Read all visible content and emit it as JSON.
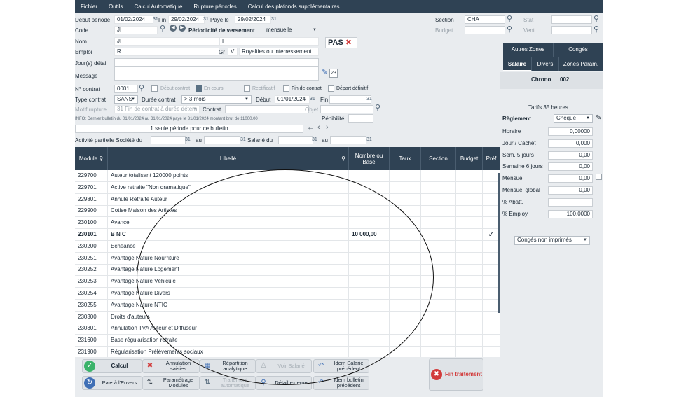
{
  "menu": [
    "Fichier",
    "Outils",
    "Calcul Automatique",
    "Rupture périodes",
    "Calcul des plafonds supplémentaires"
  ],
  "header": {
    "debut_periode_label": "Début période",
    "debut_periode": "01/02/2024",
    "fin_label": "Fin",
    "fin": "29/02/2024",
    "paye_le_label": "Payé le",
    "paye_le": "29/02/2024",
    "section_label": "Section",
    "section": "CHA",
    "stat_label": "Stat",
    "budget_label": "Budget",
    "vent_label": "Vent",
    "code_label": "Code",
    "code": "JI",
    "periodicite_label": "Périodicité de versement",
    "periodicite": "mensuelle",
    "nom_label": "Nom",
    "nom": "JI",
    "nom2": "F",
    "emploi_label": "Emploi",
    "emploi": "R",
    "gr_label": "Gr",
    "gr": "V",
    "gr_desc": "Royalties ou Interressement",
    "jours_detail_label": "Jour(s) détail",
    "message_label": "Message",
    "pas_label": "PAS",
    "calendar_day": "23"
  },
  "contract": {
    "numero_label": "N° contrat",
    "numero": "0001",
    "debut_contrat_label": "Début contrat",
    "en_cours_label": "En cours",
    "rectificatif_label": "Rectificatif",
    "fin_de_contrat_label": "Fin de contrat",
    "depart_definitif_label": "Départ définitif",
    "type_label": "Type contrat",
    "type": "SANS",
    "duree_label": "Durée contrat",
    "duree": "> 3 mois",
    "debut_label": "Début",
    "debut": "01/01/2024",
    "fin_label": "Fin",
    "motif_label": "Motif rupture",
    "motif": "31 Fin de contrat à durée détern",
    "contrat_label": "Contrat",
    "objet_label": "Objet",
    "info": "INFO: Dernier bulletin du 01/01/2024 au 31/01/2024 payé le 31/01/2024 montant brut de    11000.00",
    "penibilite_label": "Pénibilité",
    "periode_msg": "1 seule période pour ce bulletin",
    "activite_label": "Activité partielle Société du",
    "au_label": "au",
    "salarie_label": "Salarié du",
    "au2_label": "au"
  },
  "grid": {
    "headers": [
      "Module",
      "Libellé",
      "Nombre ou Base",
      "Taux",
      "Section",
      "Budget",
      "Préf"
    ],
    "rows": [
      {
        "module": "229700",
        "libelle": "Auteur totalisant 120000 points",
        "base": "",
        "check": ""
      },
      {
        "module": "229701",
        "libelle": "Active retraite \"Non dramatique\"",
        "base": "",
        "check": ""
      },
      {
        "module": "229801",
        "libelle": "Annule Retraite Auteur",
        "base": "",
        "check": ""
      },
      {
        "module": "229900",
        "libelle": "Cotise Maison des Artistes",
        "base": "",
        "check": ""
      },
      {
        "module": "230100",
        "libelle": "Avance",
        "base": "",
        "check": ""
      },
      {
        "module": "230101",
        "libelle": "B N C",
        "base": "10 000,00",
        "check": "✓",
        "bold": true
      },
      {
        "module": "230200",
        "libelle": "Echéance",
        "base": "",
        "check": ""
      },
      {
        "module": "230251",
        "libelle": "Avantage Nature Nourriture",
        "base": "",
        "check": ""
      },
      {
        "module": "230252",
        "libelle": "Avantage Nature Logement",
        "base": "",
        "check": ""
      },
      {
        "module": "230253",
        "libelle": "Avantage Nature Véhicule",
        "base": "",
        "check": ""
      },
      {
        "module": "230254",
        "libelle": "Avantage Nature Divers",
        "base": "",
        "check": ""
      },
      {
        "module": "230255",
        "libelle": "Avantage Nature NTIC",
        "base": "",
        "check": ""
      },
      {
        "module": "230300",
        "libelle": "Droits d'auteurs",
        "base": "",
        "check": ""
      },
      {
        "module": "230301",
        "libelle": "Annulation TVA Auteur et Diffuseur",
        "base": "",
        "check": ""
      },
      {
        "module": "231600",
        "libelle": "Base régularisation retraite",
        "base": "",
        "check": ""
      },
      {
        "module": "231900",
        "libelle": "Régularisation Prélévements sociaux",
        "base": "",
        "check": ""
      }
    ]
  },
  "right_panel": {
    "tabs_top": [
      "Autres Zones",
      "Congés"
    ],
    "tabs_bottom": [
      "Salaire",
      "Divers",
      "Zones Param."
    ],
    "chrono_label": "Chrono",
    "chrono": "002",
    "tarifs": "Tarifs 35 heures",
    "reglement_label": "Règlement",
    "reglement": "Chèque",
    "fields": [
      {
        "label": "Horaire",
        "value": "0,00000"
      },
      {
        "label": "Jour / Cachet",
        "value": "0,000"
      },
      {
        "label": "Sem. 5 jours",
        "value": "0,00"
      },
      {
        "label": "Semaine 6 jours",
        "value": "0,00"
      },
      {
        "label": "Mensuel",
        "value": "0,00"
      },
      {
        "label": "Mensuel global",
        "value": "0,00"
      },
      {
        "label": "% Abatt.",
        "value": ""
      },
      {
        "label": "% Employ.",
        "value": "100,0000"
      }
    ],
    "conges": "Congés non imprimés"
  },
  "buttons": {
    "calcul": "Calcul",
    "annulation": "Annulation saisies",
    "repartition": "Répartition analytique",
    "voir_salarie": "Voir Salarié",
    "idem_salarie": "Idem Salarié précédent",
    "paie_envers": "Paie à l'Envers",
    "parametrage": "Paramétrage Modules",
    "traitement": "Traitement automatique",
    "detail_externe": "Détail externe",
    "idem_bulletin": "Idem bulletin précédent",
    "fin_traitement": "Fin traitement"
  }
}
